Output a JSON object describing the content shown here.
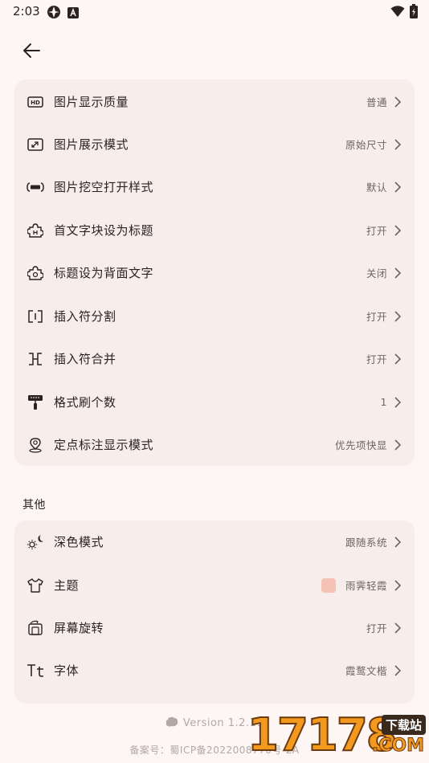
{
  "status_bar": {
    "time": "2:03"
  },
  "settings_group_1": {
    "items": [
      {
        "label": "图片显示质量",
        "value": "普通",
        "icon": "hd-icon"
      },
      {
        "label": "图片展示模式",
        "value": "原始尺寸",
        "icon": "expand-icon"
      },
      {
        "label": "图片挖空打开样式",
        "value": "默认",
        "icon": "bar-icon"
      },
      {
        "label": "首文字块设为标题",
        "value": "打开",
        "icon": "puzzle-icon"
      },
      {
        "label": "标题设为背面文字",
        "value": "关闭",
        "icon": "puzzle-gear-icon"
      },
      {
        "label": "插入符分割",
        "value": "打开",
        "icon": "split-icon"
      },
      {
        "label": "插入符合并",
        "value": "打开",
        "icon": "merge-icon"
      },
      {
        "label": "格式刷个数",
        "value": "1",
        "icon": "paint-roller-icon"
      },
      {
        "label": "定点标注显示模式",
        "value": "优先项快显",
        "icon": "pin-icon"
      }
    ]
  },
  "other_section": {
    "title": "其他",
    "items": [
      {
        "label": "深色模式",
        "value": "跟随系统",
        "icon": "sun-moon-icon"
      },
      {
        "label": "主题",
        "value": "雨霁轻霞",
        "icon": "shirt-icon",
        "swatch_color": "#f7c2b6"
      },
      {
        "label": "屏幕旋转",
        "value": "打开",
        "icon": "rotate-icon"
      },
      {
        "label": "字体",
        "value": "霞鹜文楷",
        "icon": "font-icon"
      }
    ]
  },
  "footer": {
    "version": "Version 1.2.11",
    "icp": "备案号：蜀ICP备2022008770号-2A"
  },
  "watermark": {
    "number": "17178",
    "badge": "下载站",
    "domain": ".COM"
  },
  "colors": {
    "background": "#fdf6f4",
    "card": "#f7eeec",
    "text": "#2b2322",
    "secondary_text": "#6f6462",
    "theme_swatch": "#f7c2b6"
  }
}
